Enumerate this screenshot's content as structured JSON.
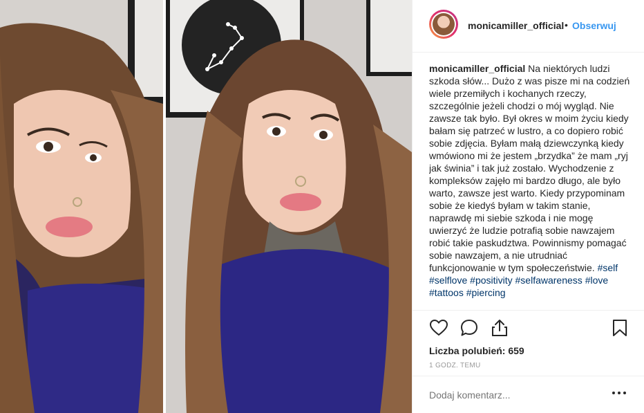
{
  "post": {
    "username": "monicamiller_official",
    "follow_label": "Obserwuj",
    "separator": "•"
  },
  "caption": {
    "username": "monicamiller_official",
    "text": "Na niektórych ludzi szkoda słów... Dużo z was pisze mi na codzień wiele przemiłych i kochanych rzeczy, szczególnie jeżeli chodzi o mój wygląd. Nie zawsze tak było. Był okres w moim życiu kiedy bałam się patrzeć w lustro, a co dopiero robić sobie zdjęcia. Byłam małą dziewczynką kiedy wmówiono mi że jestem „brzydka” że mam „ryj jak świnia” i tak już zostało. Wychodzenie z kompleksów zajęło mi bardzo długo, ale było warto, zawsze jest warto. Kiedy przypominam sobie że kiedyś byłam w takim stanie, naprawdę mi siebie szkoda i nie mogę uwierzyć że ludzie potrafią sobie nawzajem robić takie paskudztwa. Powinnismy pomagać sobie nawzajem, a nie utrudniać funkcjonowanie w tym społeczeństwie.",
    "hashtags": [
      "#self",
      "#selflove",
      "#positivity",
      "#selfawareness",
      "#love",
      "#tattoos",
      "#piercing"
    ]
  },
  "likes_text": "Liczba polubień: 659",
  "timestamp": "1 godz. temu",
  "comment_placeholder": "Dodaj komentarz...",
  "icons": [
    "heart-icon",
    "comment-icon",
    "share-icon",
    "bookmark-icon",
    "more-options-icon"
  ],
  "colors": {
    "accent": "#3897f0",
    "text": "#262626",
    "muted": "#999999",
    "hashtag": "#003569"
  }
}
